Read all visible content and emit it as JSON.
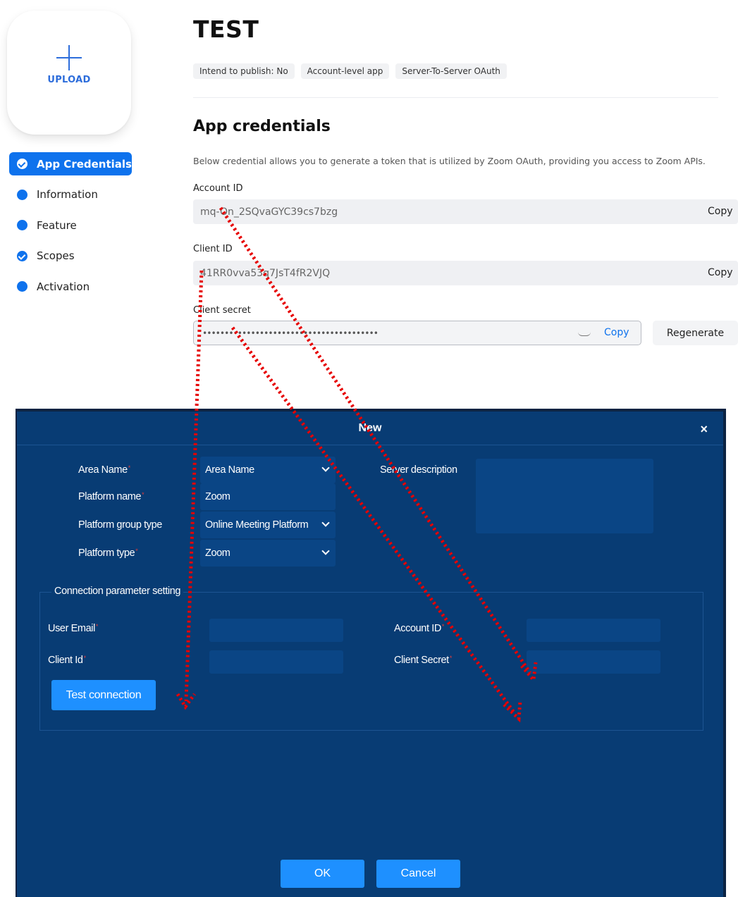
{
  "upload": {
    "label": "UPLOAD"
  },
  "sidebar": {
    "items": [
      {
        "label": "App Credentials",
        "status": "checked",
        "active": true
      },
      {
        "label": "Information",
        "status": "dot"
      },
      {
        "label": "Feature",
        "status": "dot"
      },
      {
        "label": "Scopes",
        "status": "checked"
      },
      {
        "label": "Activation",
        "status": "dot"
      }
    ]
  },
  "app": {
    "title": "TEST",
    "tags": [
      "Intend to publish: No",
      "Account-level app",
      "Server-To-Server OAuth"
    ]
  },
  "credentials": {
    "heading": "App credentials",
    "description": "Below credential allows you to generate a token that is utilized by Zoom OAuth, providing you access to Zoom APIs.",
    "account_id": {
      "label": "Account ID",
      "value": "mq-On_2SQvaGYC39cs7bzg",
      "copy": "Copy"
    },
    "client_id": {
      "label": "Client ID",
      "value": "41RR0vva53q7JsT4fR2VJQ",
      "copy": "Copy"
    },
    "client_secret": {
      "label": "Client secret",
      "value": "••••••••••••••••••••••••••••••••••••••••",
      "copy": "Copy",
      "regenerate": "Regenerate"
    }
  },
  "dialog": {
    "title": "New",
    "close": "×",
    "area_name": {
      "label": "Area Name",
      "value": "Area Name"
    },
    "platform_name": {
      "label": "Platform name",
      "value": "Zoom"
    },
    "platform_group_type": {
      "label": "Platform group type",
      "value": "Online Meeting Platform"
    },
    "platform_type": {
      "label": "Platform type",
      "value": "Zoom"
    },
    "server_description": {
      "label": "Server description"
    },
    "connection": {
      "legend": "Connection parameter setting",
      "user_email": "User Email",
      "client_id": "Client Id",
      "account_id": "Account ID",
      "client_secret": "Client Secret",
      "test_button": "Test connection"
    },
    "ok": "OK",
    "cancel": "Cancel"
  },
  "colors": {
    "accent": "#0e72ed",
    "dialog_bg": "#083c74",
    "dialog_input": "#0a4585",
    "button_blue": "#1e90ff",
    "annotation_arrow": "#e60000"
  }
}
